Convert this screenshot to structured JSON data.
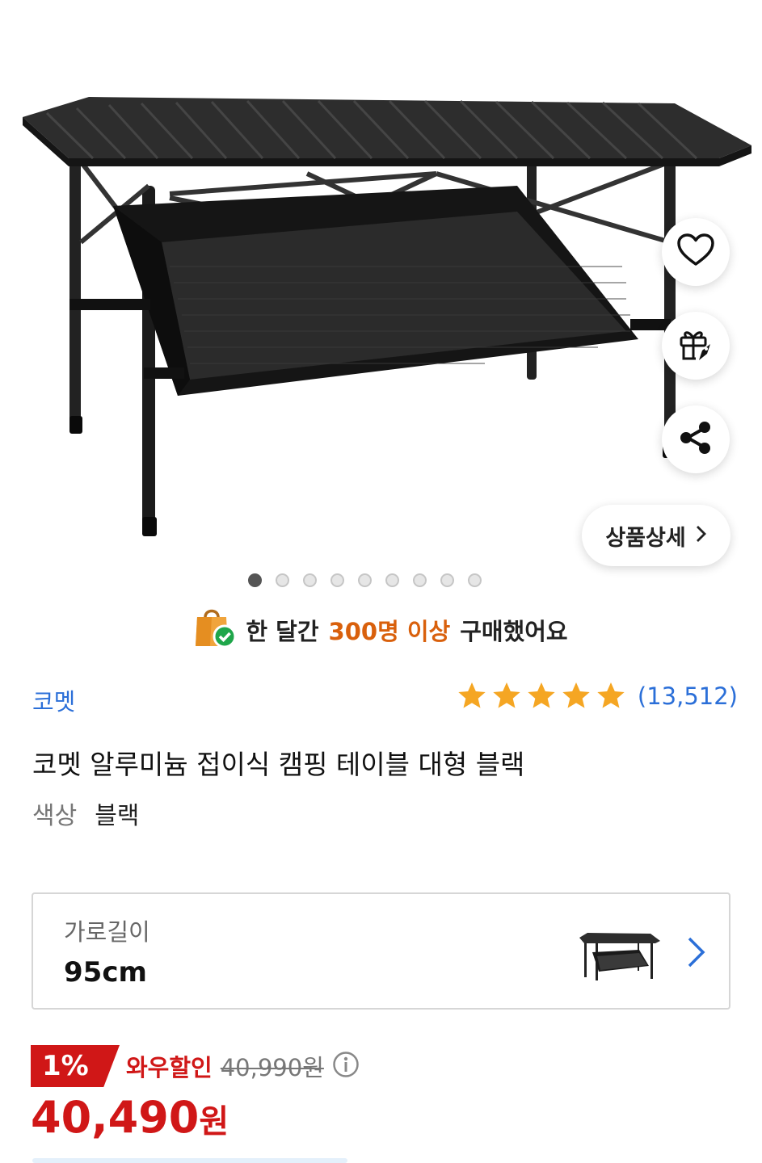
{
  "product_image": {
    "alt_icon": "folding-camping-table-image"
  },
  "actions": {
    "wishlist_icon": "heart-icon",
    "gift_icon": "gift-icon",
    "share_icon": "share-icon"
  },
  "detail_button": {
    "label": "상품상세",
    "icon": "chevron-right-icon"
  },
  "carousel": {
    "total": 9,
    "active_index": 0
  },
  "social_proof": {
    "prefix": "한 달간",
    "highlight": "300명 이상",
    "suffix": "구매했어요"
  },
  "brand": "코멧",
  "rating": {
    "stars": 5,
    "count": "(13,512)",
    "star_color": "#f5a623"
  },
  "title": "코멧 알루미늄 접이식 캠핑 테이블 대형 블랙",
  "option": {
    "label": "색상",
    "value": "블랙"
  },
  "option_selector": {
    "label": "가로길이",
    "value": "95cm"
  },
  "price": {
    "discount": "1%",
    "wow_label": "와우할인",
    "original": "40,990원",
    "final_amount": "40,490",
    "final_unit": "원"
  },
  "colors": {
    "accent_red": "#d01717",
    "link_blue": "#2b6fd8",
    "highlight_orange": "#d9600c"
  }
}
